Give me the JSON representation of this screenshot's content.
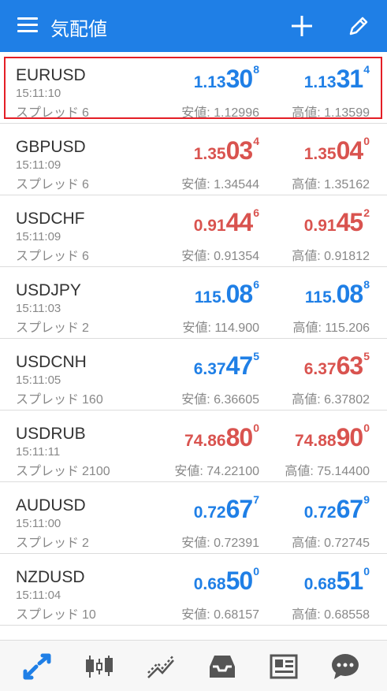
{
  "header": {
    "title": "気配値"
  },
  "rows": [
    {
      "symbol": "EURUSD",
      "time": "15:11:10",
      "spread_label": "スプレッド",
      "spread": "6",
      "bid_small": "1.13",
      "bid_big": "30",
      "bid_sup": "8",
      "ask_small": "1.13",
      "ask_big": "31",
      "ask_sup": "4",
      "bid_color": "blue",
      "ask_color": "blue",
      "low_label": "安値:",
      "low": "1.12996",
      "high_label": "高値:",
      "high": "1.13599",
      "selected": true
    },
    {
      "symbol": "GBPUSD",
      "time": "15:11:09",
      "spread_label": "スプレッド",
      "spread": "6",
      "bid_small": "1.35",
      "bid_big": "03",
      "bid_sup": "4",
      "ask_small": "1.35",
      "ask_big": "04",
      "ask_sup": "0",
      "bid_color": "red",
      "ask_color": "red",
      "low_label": "安値:",
      "low": "1.34544",
      "high_label": "高値:",
      "high": "1.35162"
    },
    {
      "symbol": "USDCHF",
      "time": "15:11:09",
      "spread_label": "スプレッド",
      "spread": "6",
      "bid_small": "0.91",
      "bid_big": "44",
      "bid_sup": "6",
      "ask_small": "0.91",
      "ask_big": "45",
      "ask_sup": "2",
      "bid_color": "red",
      "ask_color": "red",
      "low_label": "安値:",
      "low": "0.91354",
      "high_label": "高値:",
      "high": "0.91812"
    },
    {
      "symbol": "USDJPY",
      "time": "15:11:03",
      "spread_label": "スプレッド",
      "spread": "2",
      "bid_small": "115.",
      "bid_big": "08",
      "bid_sup": "6",
      "ask_small": "115.",
      "ask_big": "08",
      "ask_sup": "8",
      "bid_color": "blue",
      "ask_color": "blue",
      "low_label": "安値:",
      "low": "114.900",
      "high_label": "高値:",
      "high": "115.206"
    },
    {
      "symbol": "USDCNH",
      "time": "15:11:05",
      "spread_label": "スプレッド",
      "spread": "160",
      "bid_small": "6.37",
      "bid_big": "47",
      "bid_sup": "5",
      "ask_small": "6.37",
      "ask_big": "63",
      "ask_sup": "5",
      "bid_color": "blue",
      "ask_color": "red",
      "low_label": "安値:",
      "low": "6.36605",
      "high_label": "高値:",
      "high": "6.37802"
    },
    {
      "symbol": "USDRUB",
      "time": "15:11:11",
      "spread_label": "スプレッド",
      "spread": "2100",
      "bid_small": "74.86",
      "bid_big": "80",
      "bid_sup": "0",
      "ask_small": "74.88",
      "ask_big": "90",
      "ask_sup": "0",
      "bid_color": "red",
      "ask_color": "red",
      "low_label": "安値:",
      "low": "74.22100",
      "high_label": "高値:",
      "high": "75.14400"
    },
    {
      "symbol": "AUDUSD",
      "time": "15:11:00",
      "spread_label": "スプレッド",
      "spread": "2",
      "bid_small": "0.72",
      "bid_big": "67",
      "bid_sup": "7",
      "ask_small": "0.72",
      "ask_big": "67",
      "ask_sup": "9",
      "bid_color": "blue",
      "ask_color": "blue",
      "low_label": "安値:",
      "low": "0.72391",
      "high_label": "高値:",
      "high": "0.72745"
    },
    {
      "symbol": "NZDUSD",
      "time": "15:11:04",
      "spread_label": "スプレッド",
      "spread": "10",
      "bid_small": "0.68",
      "bid_big": "50",
      "bid_sup": "0",
      "ask_small": "0.68",
      "ask_big": "51",
      "ask_sup": "0",
      "bid_color": "blue",
      "ask_color": "blue",
      "low_label": "安値:",
      "low": "0.68157",
      "high_label": "高値:",
      "high": "0.68558"
    }
  ],
  "colors": {
    "accent": "#1f7fe6",
    "up": "#1f7fe6",
    "down": "#d9534f",
    "selection": "#e41e26"
  },
  "tabs": [
    {
      "icon": "quotes-icon",
      "active": true
    },
    {
      "icon": "chart-icon"
    },
    {
      "icon": "trade-icon"
    },
    {
      "icon": "history-icon"
    },
    {
      "icon": "news-icon"
    },
    {
      "icon": "chat-icon"
    }
  ]
}
